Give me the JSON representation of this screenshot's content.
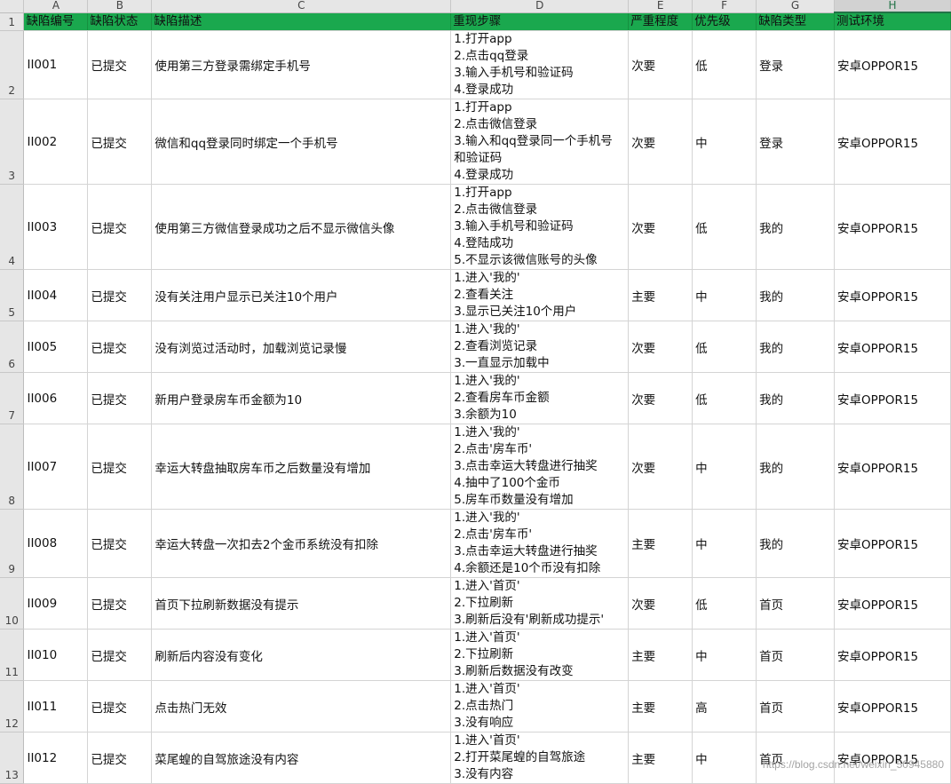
{
  "columns": [
    "A",
    "B",
    "C",
    "D",
    "E",
    "F",
    "G",
    "H"
  ],
  "selected_column": "H",
  "header_row_number": "1",
  "headers": [
    "缺陷编号",
    "缺陷状态",
    "缺陷描述",
    "重现步骤",
    "严重程度",
    "优先级",
    "缺陷类型",
    "测试环境"
  ],
  "rows": [
    {
      "num": "2",
      "cells": [
        "II001",
        "已提交",
        "使用第三方登录需绑定手机号",
        "",
        "次要",
        "低",
        "登录",
        "安卓OPPOR15"
      ],
      "steps": [
        "1.打开app",
        "2.点击qq登录",
        "3.输入手机号和验证码",
        "4.登录成功"
      ]
    },
    {
      "num": "3",
      "cells": [
        "II002",
        "已提交",
        "微信和qq登录同时绑定一个手机号",
        "",
        "次要",
        "中",
        "登录",
        "安卓OPPOR15"
      ],
      "steps": [
        "1.打开app",
        "2.点击微信登录",
        "3.输入和qq登录同一个手机号",
        "和验证码",
        "4.登录成功"
      ]
    },
    {
      "num": "4",
      "cells": [
        "II003",
        "已提交",
        "使用第三方微信登录成功之后不显示微信头像",
        "",
        "次要",
        "低",
        "我的",
        "安卓OPPOR15"
      ],
      "steps": [
        "1.打开app",
        "2.点击微信登录",
        "3.输入手机号和验证码",
        "4.登陆成功",
        "5.不显示该微信账号的头像"
      ]
    },
    {
      "num": "5",
      "cells": [
        "II004",
        "已提交",
        "没有关注用户显示已关注10个用户",
        "",
        "主要",
        "中",
        "我的",
        "安卓OPPOR15"
      ],
      "steps": [
        "1.进入'我的'",
        "2.查看关注",
        "3.显示已关注10个用户"
      ]
    },
    {
      "num": "6",
      "cells": [
        "II005",
        "已提交",
        "没有浏览过活动时，加载浏览记录慢",
        "",
        "次要",
        "低",
        "我的",
        "安卓OPPOR15"
      ],
      "steps": [
        "1.进入'我的'",
        "2.查看浏览记录",
        "3.一直显示加载中"
      ]
    },
    {
      "num": "7",
      "cells": [
        "II006",
        "已提交",
        "新用户登录房车币金额为10",
        "",
        "次要",
        "低",
        "我的",
        "安卓OPPOR15"
      ],
      "steps": [
        "1.进入'我的'",
        "2.查看房车币金额",
        "3.余额为10"
      ]
    },
    {
      "num": "8",
      "cells": [
        "II007",
        "已提交",
        "幸运大转盘抽取房车币之后数量没有增加",
        "",
        "次要",
        "中",
        "我的",
        "安卓OPPOR15"
      ],
      "steps": [
        "1.进入'我的'",
        "2.点击'房车币'",
        "3.点击幸运大转盘进行抽奖",
        "4.抽中了100个金币",
        "5.房车币数量没有增加"
      ]
    },
    {
      "num": "9",
      "cells": [
        "II008",
        "已提交",
        "幸运大转盘一次扣去2个金币系统没有扣除",
        "",
        "主要",
        "中",
        "我的",
        "安卓OPPOR15"
      ],
      "steps": [
        "1.进入'我的'",
        "2.点击'房车币'",
        "3.点击幸运大转盘进行抽奖",
        "4.余额还是10个币没有扣除"
      ]
    },
    {
      "num": "10",
      "cells": [
        "II009",
        "已提交",
        "首页下拉刷新数据没有提示",
        "",
        "次要",
        "低",
        "首页",
        "安卓OPPOR15"
      ],
      "steps": [
        "1.进入'首页'",
        "2.下拉刷新",
        "3.刷新后没有'刷新成功提示'"
      ]
    },
    {
      "num": "11",
      "cells": [
        "II010",
        "已提交",
        "刷新后内容没有变化",
        "",
        "主要",
        "中",
        "首页",
        "安卓OPPOR15"
      ],
      "steps": [
        "1.进入'首页'",
        "2.下拉刷新",
        "3.刷新后数据没有改变"
      ]
    },
    {
      "num": "12",
      "cells": [
        "II011",
        "已提交",
        "点击热门无效",
        "",
        "主要",
        "高",
        "首页",
        "安卓OPPOR15"
      ],
      "steps": [
        "1.进入'首页'",
        "2.点击热门",
        "3.没有响应"
      ]
    },
    {
      "num": "13",
      "cells": [
        "II012",
        "已提交",
        "菜尾蝗的自驾旅途没有内容",
        "",
        "主要",
        "中",
        "首页",
        "安卓OPPOR15"
      ],
      "steps": [
        "1.进入'首页'",
        "2.打开菜尾蝗的自驾旅途",
        "3.没有内容"
      ]
    }
  ],
  "watermark": "https://blog.csdn.net/weixin_50945880"
}
